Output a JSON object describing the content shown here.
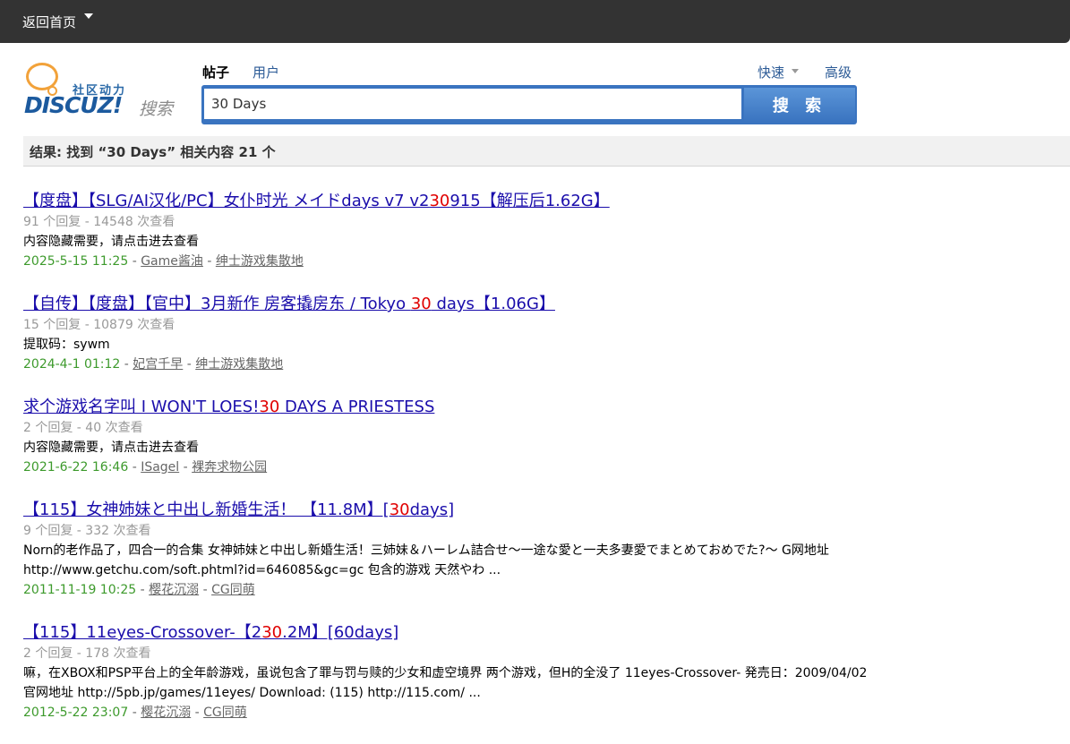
{
  "topbar": {
    "home_label": "返回首页"
  },
  "logo": {
    "slogan": "社区动力",
    "brand": "DISCUZ!",
    "suffix": "搜索"
  },
  "search": {
    "tabs": [
      "帖子",
      "用户"
    ],
    "quick_label": "快速",
    "advanced_label": "高级",
    "query": "30 Days",
    "button_label": "搜 索"
  },
  "result_summary": "结果: 找到 “30 Days” 相关内容 21 个",
  "results": [
    {
      "title_before": "【度盘】【SLG/AI汉化/PC】女仆时光 メイドdays v7 v2",
      "title_hl": "30",
      "title_after": "915【解压后1.62G】",
      "meta": "91 个回复 - 14548 次查看",
      "desc": "内容隐藏需要，请点击进去查看",
      "date": "2025-5-15 11:25",
      "author": "Game酱油",
      "forum": "绅士游戏集散地"
    },
    {
      "title_before": "【自传】【度盘】【官中】3月新作 房客撬房东 / Tokyo ",
      "title_hl": "30",
      "title_after": " days【1.06G】",
      "meta": "15 个回复 - 10879 次查看",
      "desc": "提取码：sywm",
      "date": "2024-4-1 01:12",
      "author": "妃宫千早",
      "forum": "绅士游戏集散地"
    },
    {
      "title_before": "求个游戏名字叫 I WON'T LOES!",
      "title_hl": "30",
      "title_after": " DAYS A PRIESTESS",
      "meta": "2 个回复 - 40 次查看",
      "desc": "内容隐藏需要，请点击进去查看",
      "date": "2021-6-22 16:46",
      "author": "ISagel",
      "forum": "裸奔求物公园"
    },
    {
      "title_before": "【115】女神姉妹と中出し新婚生活！ 【11.8M】[",
      "title_hl": "30",
      "title_after": "days]",
      "meta": "9 个回复 - 332 次查看",
      "desc": "Norn的老作品了，四合一的合集 女神姉妹と中出し新婚生活！三姉妹＆ハーレム詰合せ～一途な愛と一夫多妻愛でまとめておめでた?～ G网地址 http://www.getchu.com/soft.phtml?id=646085&gc=gc 包含的游戏 天然やわ ...",
      "date": "2011-11-19 10:25",
      "author": "樱花沉溺",
      "forum": "CG同萌"
    },
    {
      "title_before": "【115】11eyes-Crossover-【2",
      "title_hl": "30",
      "title_after": ".2M】[60days]",
      "meta": "2 个回复 - 178 次查看",
      "desc": "嘛，在XBOX和PSP平台上的全年龄游戏，虽说包含了罪与罚与赎的少女和虚空境界 两个游戏，但H的全没了 11eyes-Crossover- 発売日：2009/04/02 官网地址 http://5pb.jp/games/11eyes/ Download: (115) http://115.com/ ...",
      "date": "2012-5-22 23:07",
      "author": "樱花沉溺",
      "forum": "CG同萌"
    }
  ]
}
